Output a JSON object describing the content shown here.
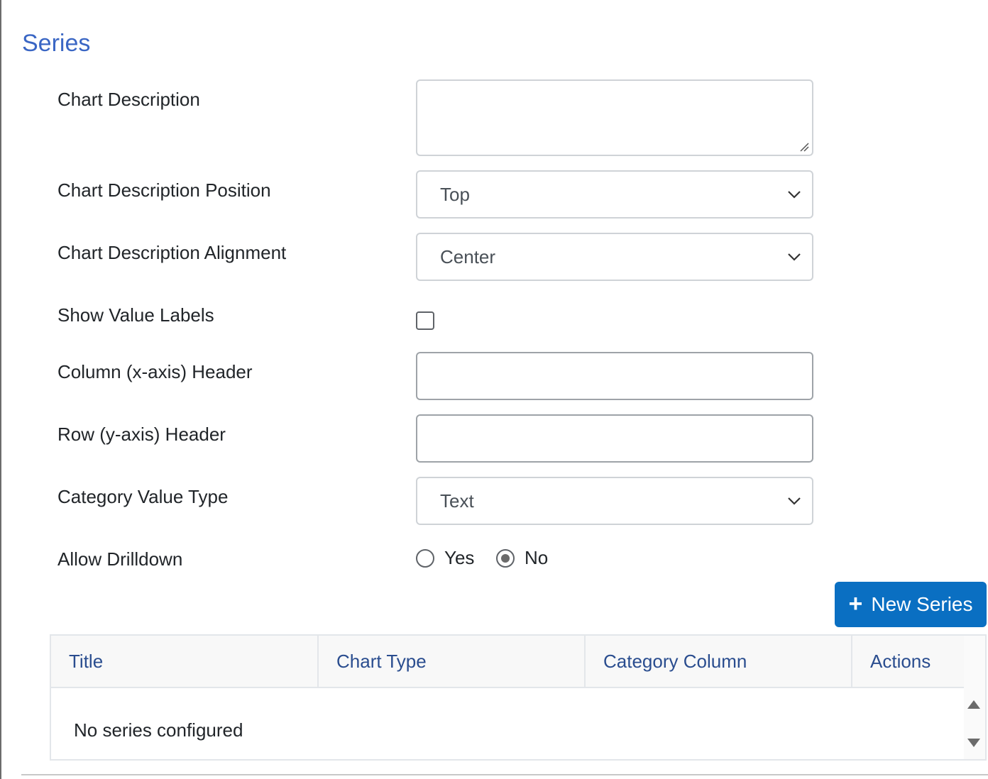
{
  "section": {
    "title": "Series"
  },
  "form": {
    "chart_description": {
      "label": "Chart Description",
      "value": ""
    },
    "chart_description_position": {
      "label": "Chart Description Position",
      "value": "Top"
    },
    "chart_description_alignment": {
      "label": "Chart Description Alignment",
      "value": "Center"
    },
    "show_value_labels": {
      "label": "Show Value Labels",
      "checked": false
    },
    "column_header": {
      "label": "Column (x-axis) Header",
      "value": ""
    },
    "row_header": {
      "label": "Row (y-axis) Header",
      "value": ""
    },
    "category_value_type": {
      "label": "Category Value Type",
      "value": "Text"
    },
    "allow_drilldown": {
      "label": "Allow Drilldown",
      "options": [
        "Yes",
        "No"
      ],
      "selected": "No"
    }
  },
  "toolbar": {
    "new_series_label": "New Series",
    "new_series_icon": "plus-icon"
  },
  "table": {
    "columns": [
      "Title",
      "Chart Type",
      "Category Column",
      "Actions"
    ],
    "empty_message": "No series configured"
  },
  "colors": {
    "section_title": "#3a66c4",
    "primary_button": "#0a6fc2",
    "table_header_text": "#2a4d8f"
  }
}
